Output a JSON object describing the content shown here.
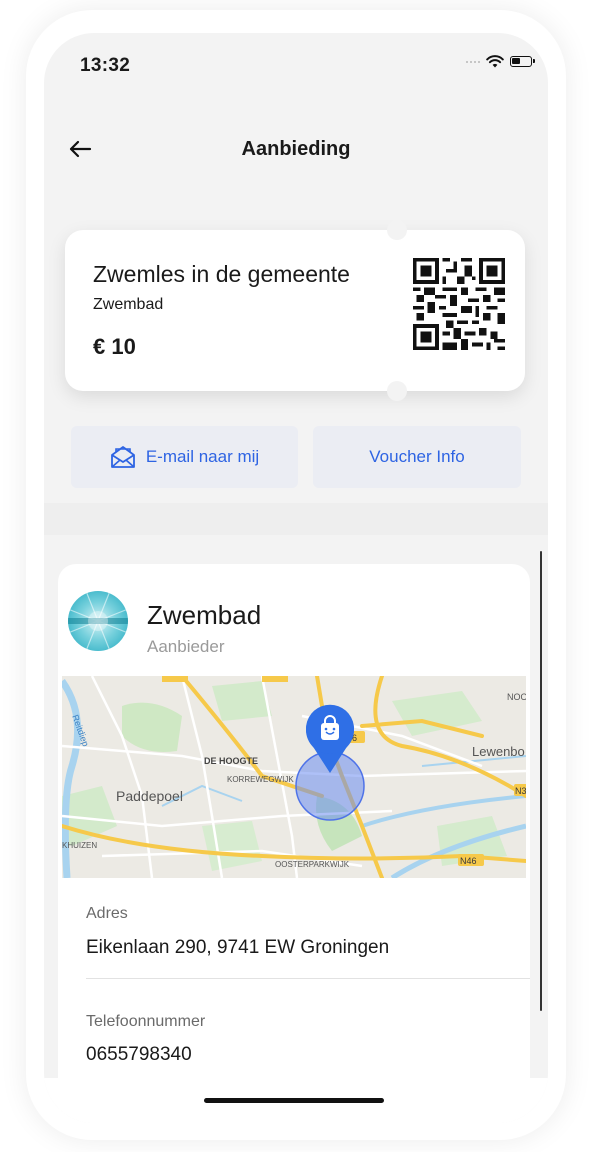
{
  "status_bar": {
    "time": "13:32"
  },
  "header": {
    "title": "Aanbieding"
  },
  "voucher": {
    "title": "Zwemles in de gemeente",
    "provider": "Zwembad",
    "price": "€ 10"
  },
  "actions": {
    "email_label": "E-mail naar mij",
    "info_label": "Voucher Info"
  },
  "provider": {
    "name": "Zwembad",
    "role": "Aanbieder"
  },
  "map": {
    "labels": {
      "paddepoel": "Paddepoel",
      "dehoogte": "DE HOOGTE",
      "korrewegwijk": "KORREWEGWIJK",
      "oosterparkwijk": "OOSTERPARKWIJK",
      "lewenborg": "Lewenbo",
      "noord": "NOOF",
      "n46a": "46",
      "n46b": "N46",
      "n3": "N3",
      "hoogkerk": "KHUIZEN",
      "reitdiep": "Reitdiep"
    }
  },
  "details": {
    "address_label": "Adres",
    "address_value": "Eikenlaan 290, 9741 EW Groningen",
    "phone_label": "Telefoonnummer",
    "phone_value": "0655798340"
  },
  "colors": {
    "accent": "#2e64e3",
    "marker": "#2f6fe6",
    "background": "#f3f3f3"
  }
}
